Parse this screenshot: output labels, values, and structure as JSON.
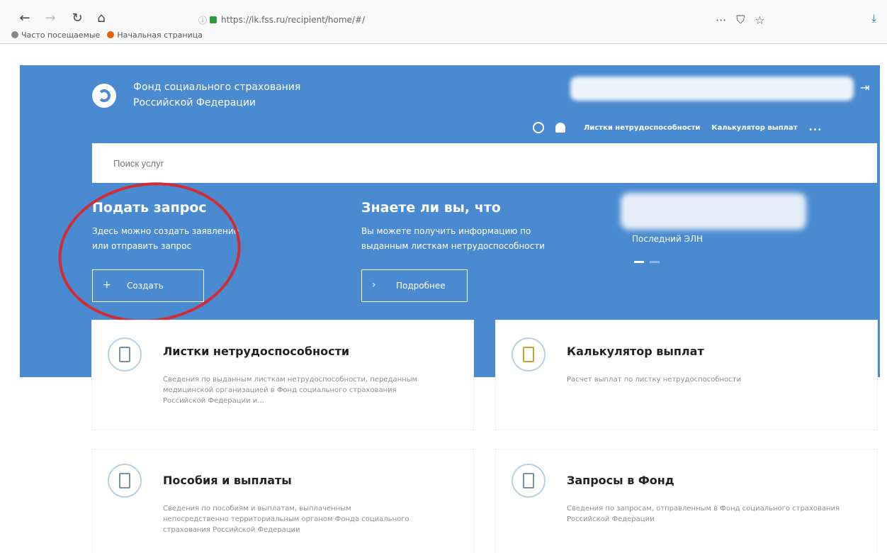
{
  "browser": {
    "url": "https://lk.fss.ru/recipient/home/#/",
    "bookmarks": [
      "Часто посещаемые",
      "Начальная страница"
    ]
  },
  "header": {
    "org_line1": "Фонд социального страхования",
    "org_line2": "Российской Федерации",
    "nav": [
      "Листки нетрудоспособности",
      "Калькулятор выплат"
    ],
    "more": "..."
  },
  "search": {
    "placeholder": "Поиск услуг"
  },
  "request_block": {
    "title": "Подать запрос",
    "text_line1": "Здесь можно создать заявление",
    "text_line2": "или отправить запрос",
    "button": "Создать"
  },
  "info_block": {
    "title": "Знаете ли вы, что",
    "text_line1": "Вы можете получить информацию по",
    "text_line2": "выданным листкам нетрудоспособности",
    "button": "Подробнее"
  },
  "eln_block": {
    "label": "Последний ЭЛН"
  },
  "cards": [
    {
      "title": "Листки нетрудоспособности",
      "desc": "Сведения по выданным листкам нетрудоспособности, переданным медицинской организацией в Фонд социального страхования Российской Федерации и..."
    },
    {
      "title": "Калькулятор выплат",
      "desc": "Расчет выплат по листку нетрудоспособности"
    },
    {
      "title": "Пособия и выплаты",
      "desc": "Сведения по пособиям и выплатам, выплаченным непосредственно территориальным органом Фонда социального страхования Российской Федерации"
    },
    {
      "title": "Запросы в Фонд",
      "desc": "Сведения по запросам, отправленным в Фонд социального страхования Российской Федерации"
    }
  ],
  "colors": {
    "brand_blue": "#4a8ad0",
    "annotation_red": "#d32b34"
  }
}
